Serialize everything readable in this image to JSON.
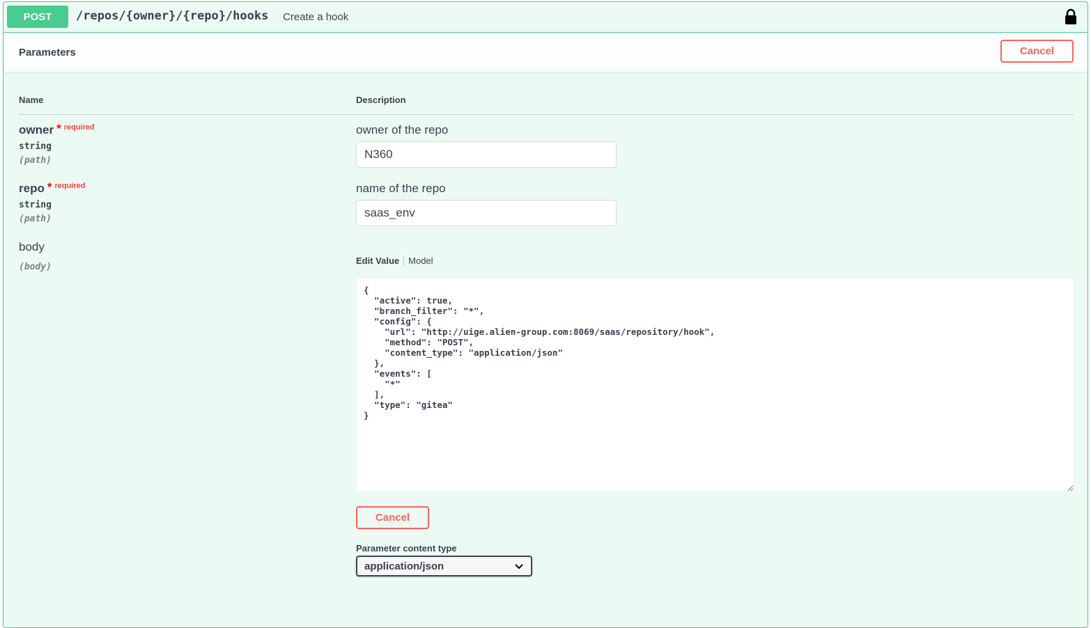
{
  "summary": {
    "method": "POST",
    "path": "/repos/{owner}/{repo}/hooks",
    "description": "Create a hook",
    "lock_icon": "lock-icon"
  },
  "parameters": {
    "title": "Parameters",
    "cancel_label": "Cancel",
    "col_name": "Name",
    "col_description": "Description",
    "required_label": "required",
    "items": [
      {
        "name": "owner",
        "type": "string",
        "in": "(path)",
        "description": "owner of the repo",
        "value": "N360"
      },
      {
        "name": "repo",
        "type": "string",
        "in": "(path)",
        "description": "name of the repo",
        "value": "saas_env"
      },
      {
        "name": "body",
        "in": "(body)"
      }
    ]
  },
  "body_editor": {
    "tab_edit": "Edit Value",
    "tab_model": "Model",
    "value": "{\n  \"active\": true,\n  \"branch_filter\": \"*\",\n  \"config\": {\n    \"url\": \"http://uige.alien-group.com:8069/saas/repository/hook\",\n    \"method\": \"POST\",\n    \"content_type\": \"application/json\"\n  },\n  \"events\": [\n    \"*\"\n  ],\n  \"type\": \"gitea\"\n}",
    "cancel_label": "Cancel"
  },
  "content_type": {
    "label": "Parameter content type",
    "selected": "application/json"
  },
  "colors": {
    "post_green": "#49cc90",
    "cancel_red": "#ff6060"
  }
}
